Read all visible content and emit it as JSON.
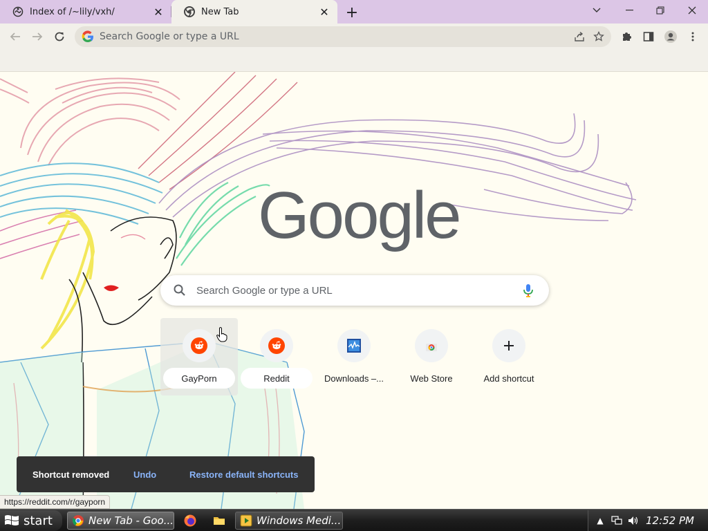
{
  "tabs": [
    {
      "title": "Index of /~lily/vxh/",
      "icon": "tilde-club-icon",
      "active": false
    },
    {
      "title": "New Tab",
      "icon": "chrome-icon",
      "active": true
    }
  ],
  "toolbar": {
    "omnibox_placeholder": "Search Google or type a URL"
  },
  "ntp": {
    "logo_text": "Google",
    "search_placeholder": "Search Google or type a URL",
    "shortcuts": [
      {
        "label": "GayPorn",
        "icon": "reddit-icon"
      },
      {
        "label": "Reddit",
        "icon": "reddit-icon"
      },
      {
        "label": "Downloads –...",
        "icon": "downloads-site-icon"
      },
      {
        "label": "Web Store",
        "icon": "chrome-web-store-icon"
      },
      {
        "label": "Add shortcut",
        "icon": "plus-icon"
      }
    ],
    "toast": {
      "message": "Shortcut removed",
      "undo": "Undo",
      "restore": "Restore default shortcuts"
    },
    "status_url": "https://reddit.com/r/gayporn"
  },
  "taskbar": {
    "start_label": "start",
    "tasks": [
      {
        "label": "New Tab - Goo...",
        "icon": "chrome-icon",
        "active": true
      },
      {
        "label": "Windows Medi...",
        "icon": "media-player-icon",
        "active": false
      }
    ],
    "quick_launch": [
      "firefox-icon",
      "folder-icon"
    ],
    "clock": "12:52 PM"
  },
  "colors": {
    "tab_strip": "#dcc6e6",
    "toolbar": "#f2f0ea",
    "ntp_background": "#fffdf2",
    "reddit_orange": "#ff4500",
    "toast_bg": "#323232",
    "toast_action": "#8ab4f8"
  }
}
